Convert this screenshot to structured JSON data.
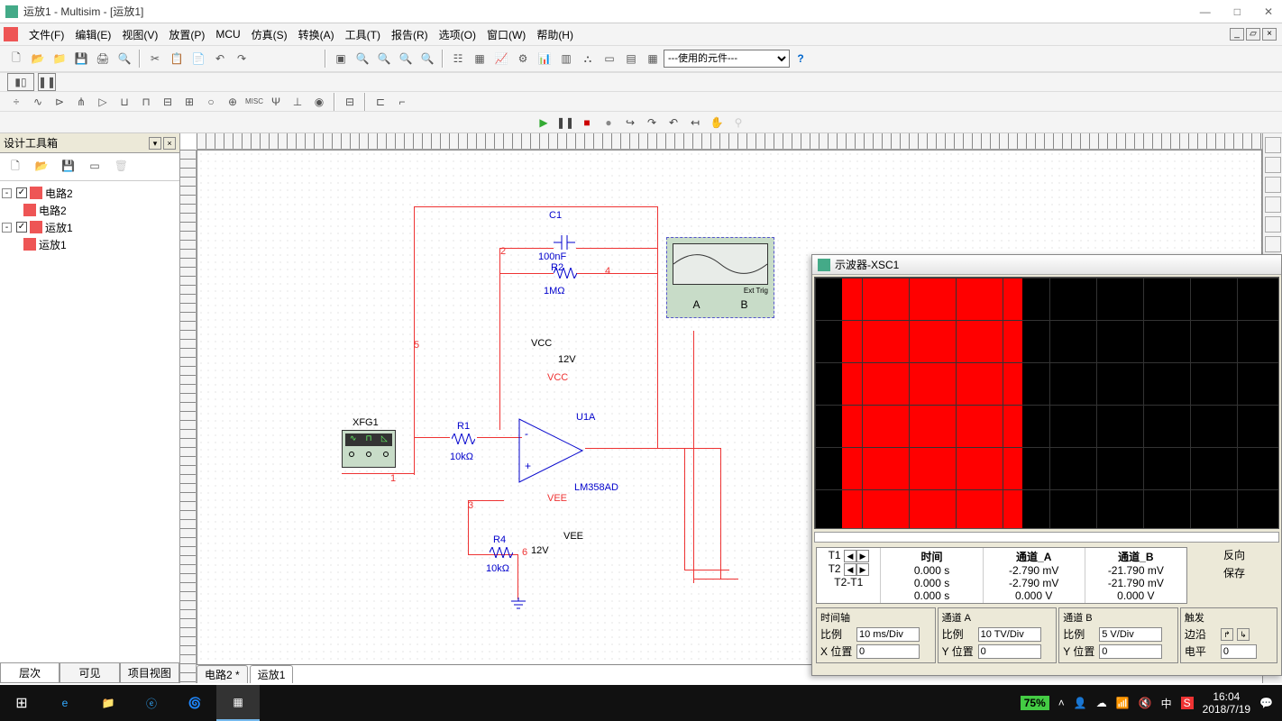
{
  "title": "运放1 - Multisim - [运放1]",
  "menu": [
    "文件(F)",
    "编辑(E)",
    "视图(V)",
    "放置(P)",
    "MCU",
    "仿真(S)",
    "转换(A)",
    "工具(T)",
    "报告(R)",
    "选项(O)",
    "窗口(W)",
    "帮助(H)"
  ],
  "component_dropdown": "---使用的元件---",
  "sidebar": {
    "title": "设计工具箱",
    "tree": [
      {
        "label": "电路2",
        "children": [
          {
            "label": "电路2"
          }
        ]
      },
      {
        "label": "运放1",
        "children": [
          {
            "label": "运放1"
          }
        ]
      }
    ],
    "tabs": [
      "层次",
      "可见",
      "项目视图"
    ]
  },
  "doctabs": [
    "电路2 *",
    "运放1"
  ],
  "schematic": {
    "xfg": {
      "ref": "XFG1"
    },
    "xsc": {
      "ref": "XSC1",
      "ext": "Ext Trig",
      "a": "A",
      "b": "B"
    },
    "comps": {
      "C1": {
        "ref": "C1",
        "val": "100nF"
      },
      "R2": {
        "ref": "R2",
        "val": "1MΩ"
      },
      "R1": {
        "ref": "R1",
        "val": "10kΩ"
      },
      "R4": {
        "ref": "R4",
        "val": "10kΩ"
      },
      "U1A": {
        "ref": "U1A",
        "model": "LM358AD"
      },
      "VCClbl": "VCC",
      "VCCval": "12V",
      "VCCnet": "VCC",
      "VEElbl": "VEE",
      "VEEval": "12V",
      "VEEnet": "VEE"
    },
    "nets": {
      "n1": "1",
      "n2": "2",
      "n3": "3",
      "n4": "4",
      "n5": "5",
      "n6": "6"
    }
  },
  "osc": {
    "title": "示波器-XSC1",
    "headers": {
      "time": "时间",
      "chA": "通道_A",
      "chB": "通道_B"
    },
    "rows": {
      "T1": {
        "k": "T1",
        "t": "0.000 s",
        "a": "-2.790 mV",
        "b": "-21.790 mV"
      },
      "T2": {
        "k": "T2",
        "t": "0.000 s",
        "a": "-2.790 mV",
        "b": "-21.790 mV"
      },
      "dT": {
        "k": "T2-T1",
        "t": "0.000 s",
        "a": "0.000 V",
        "b": "0.000 V"
      }
    },
    "buttons": {
      "reverse": "反向",
      "save": "保存"
    },
    "timebase": {
      "title": "时间轴",
      "scale_lbl": "比例",
      "scale": "10 ms/Div",
      "xpos_lbl": "X 位置",
      "xpos": "0"
    },
    "chA": {
      "title": "通道 A",
      "scale_lbl": "比例",
      "scale": "10 TV/Div",
      "ypos_lbl": "Y 位置",
      "ypos": "0"
    },
    "chB": {
      "title": "通道 B",
      "scale_lbl": "比例",
      "scale": "5 V/Div",
      "ypos_lbl": "Y 位置",
      "ypos": "0"
    },
    "trig": {
      "title": "触发",
      "edge_lbl": "边沿",
      "level_lbl": "电平",
      "level": "0"
    }
  },
  "taskbar": {
    "battery": "75%",
    "time": "16:04",
    "date": "2018/7/19",
    "ime": "中"
  }
}
